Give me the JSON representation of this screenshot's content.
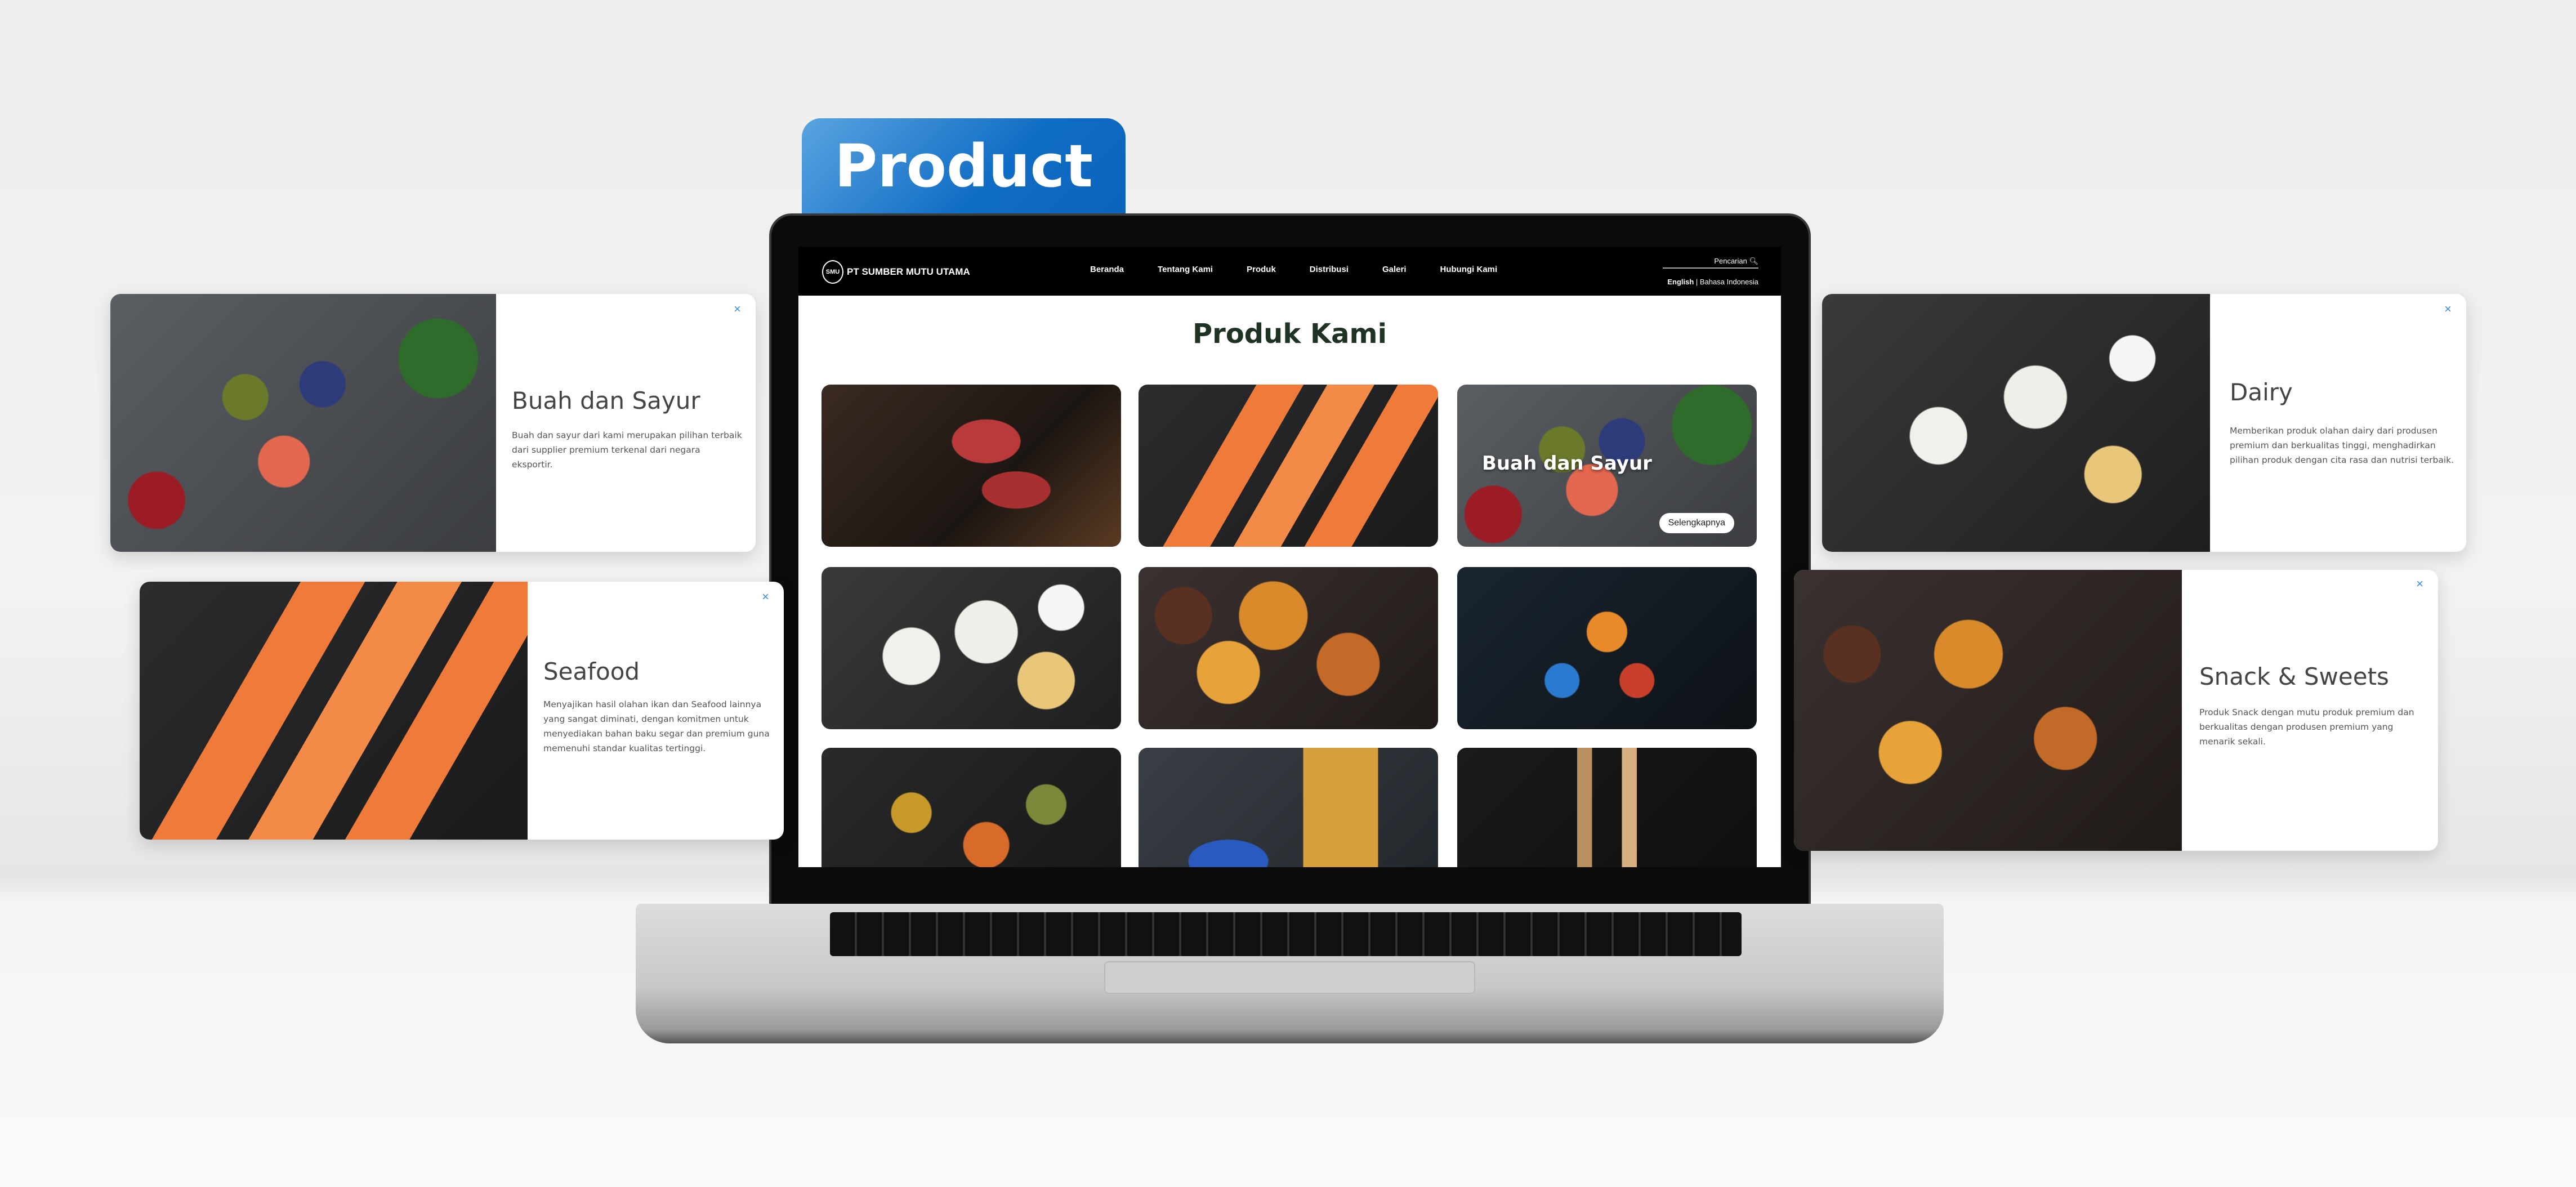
{
  "banner": {
    "label": "Product",
    "color": "#0f6cc4"
  },
  "site": {
    "company": "PT SUMBER MUTU UTAMA",
    "logo_text": "SMU",
    "nav": [
      "Beranda",
      "Tentang Kami",
      "Produk",
      "Distribusi",
      "Galeri",
      "Hubungi Kami"
    ],
    "search_placeholder": "Pencarian",
    "languages": {
      "english": "English",
      "indonesian": "Bahasa Indonesia"
    },
    "page_title": "Produk Kami",
    "tiles": [
      {
        "image": "meat"
      },
      {
        "image": "salmon"
      },
      {
        "image": "fruits-vegetables",
        "label": "Buah dan Sayur",
        "button": "Selengkapnya"
      },
      {
        "image": "dairy"
      },
      {
        "image": "snacks"
      },
      {
        "image": "drinks"
      },
      {
        "image": "spices"
      },
      {
        "image": "umbrella-luggage"
      },
      {
        "image": "cosmetics"
      }
    ]
  },
  "cards": [
    {
      "title": "Buah dan Sayur",
      "description": "Buah dan sayur dari kami merupakan pilihan terbaik dari supplier premium terkenal dari negara eksportir.",
      "close": "×"
    },
    {
      "title": "Seafood",
      "description": "Menyajikan hasil olahan ikan dan Seafood lainnya yang sangat diminati, dengan komitmen untuk menyediakan bahan baku segar dan premium guna memenuhi standar kualitas tertinggi.",
      "close": "×"
    },
    {
      "title": "Dairy",
      "description": "Memberikan produk olahan dairy dari produsen premium dan berkualitas tinggi, menghadirkan pilihan produk dengan cita rasa dan nutrisi terbaik.",
      "close": "×"
    },
    {
      "title": "Snack & Sweets",
      "description": "Produk Snack dengan mutu produk premium dan berkualitas dengan produsen premium yang menarik sekali.",
      "close": "×"
    }
  ]
}
